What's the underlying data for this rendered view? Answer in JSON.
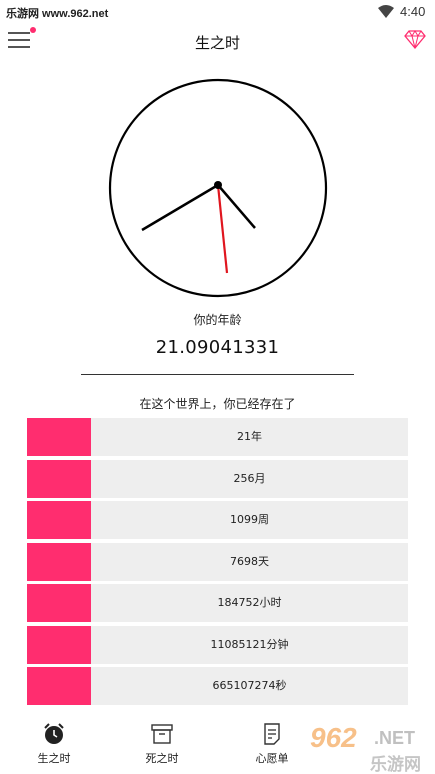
{
  "status_bar": {
    "site": "乐游网 www.962.net",
    "time": "4:40"
  },
  "app_bar": {
    "title": "生之时",
    "menu_icon": "hamburger-menu-icon",
    "vip_icon": "diamond-icon"
  },
  "clock": {
    "hour_hand": "8",
    "minute_hand": "approx 22",
    "second_hand": "approx 31",
    "colors": {
      "face": "#000000",
      "second_hand": "#e0161f"
    }
  },
  "age": {
    "label": "你的年龄",
    "value": "21.09041331"
  },
  "existence": {
    "label": "在这个世界上，你已经存在了",
    "items": [
      {
        "value": "21年"
      },
      {
        "value": "256月"
      },
      {
        "value": "1099周"
      },
      {
        "value": "7698天"
      },
      {
        "value": "184752小时"
      },
      {
        "value": "11085121分钟"
      },
      {
        "value": "665107274秒"
      }
    ]
  },
  "tabs": [
    {
      "label": "生之时",
      "icon": "alarm-clock-icon"
    },
    {
      "label": "死之时",
      "icon": "archive-box-icon"
    },
    {
      "label": "心愿单",
      "icon": "wish-list-icon"
    }
  ],
  "watermark": {
    "big": "962",
    "net": ".NET",
    "cn": "乐游网"
  },
  "colors": {
    "accent": "#ff2d6f",
    "row_background": "#eeeeee"
  }
}
